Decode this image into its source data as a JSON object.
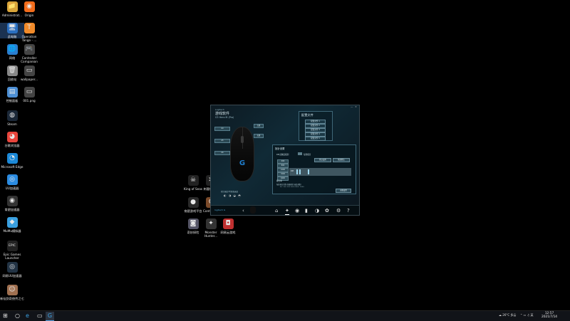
{
  "desktop": {
    "icons": [
      {
        "label": "Administrat...",
        "glyph": "📁",
        "color": "#d9a53a"
      },
      {
        "label": "Origin",
        "glyph": "◉",
        "color": "#f26c1b"
      },
      {
        "label": "此电脑",
        "glyph": "🖥",
        "color": "#2a6fc0"
      },
      {
        "label": "Operation Tango - ...",
        "glyph": "T",
        "color": "#f08a2a"
      },
      {
        "label": "网络",
        "glyph": "🌐",
        "color": "#2a7ecf"
      },
      {
        "label": "Controller Companion",
        "glyph": "🎮",
        "color": "#444"
      },
      {
        "label": "回收站",
        "glyph": "🗑",
        "color": "#888"
      },
      {
        "label": "wallpaper...",
        "glyph": "▭",
        "color": "#444"
      },
      {
        "label": "控制面板",
        "glyph": "▤",
        "color": "#4d8fd4"
      },
      {
        "label": "001.png",
        "glyph": "▭",
        "color": "#444"
      },
      {
        "label": "Steam",
        "glyph": "◍",
        "color": "#1b2838"
      },
      {
        "label": "谷歌浏览器",
        "glyph": "◕",
        "color": "#e8453c"
      },
      {
        "label": "Microsoft Edge",
        "glyph": "◔",
        "color": "#1b88d6"
      },
      {
        "label": "UU加速器",
        "glyph": "◎",
        "color": "#2b8be0"
      },
      {
        "label": "育碧加速器",
        "glyph": "◉",
        "color": "#333"
      },
      {
        "label": "MuMu模拟器",
        "glyph": "◆",
        "color": "#3aa0e0"
      },
      {
        "label": "Epic Games Launcher",
        "glyph": "EPIC",
        "color": "#222"
      },
      {
        "label": "网易UU加速器",
        "glyph": "◎",
        "color": "#234"
      },
      {
        "label": "新仙剑奇侠传之七",
        "glyph": "☺",
        "color": "#a07050"
      },
      {
        "label": "King of Seas",
        "glyph": "☠",
        "color": "#222"
      },
      {
        "label": "刺客信条...",
        "glyph": "✕",
        "color": "#222"
      },
      {
        "label": "育碧游戏平台",
        "glyph": "●",
        "color": "#2a2a2a"
      },
      {
        "label": "Contract...",
        "glyph": "C",
        "color": "#7a4a2a"
      },
      {
        "label": "奇妙探险",
        "glyph": "◙",
        "color": "#556"
      },
      {
        "label": "Monster Hunter...",
        "glyph": "✦",
        "color": "#333"
      },
      {
        "label": "网易云游戏",
        "glyph": "◘",
        "color": "#c03030"
      }
    ]
  },
  "ghub": {
    "brand": "Logitech",
    "title": "游戏软件",
    "device": "G3 Hero M (Pro)",
    "window_controls": [
      "—",
      "×"
    ],
    "profile_panel": {
      "title": "配置文件",
      "buttons": [
        "配置文件 1",
        "配置文件 2",
        "配置文件 3",
        "配置文件 4",
        "配置文件 5"
      ]
    },
    "mouse_labels_left": [
      "G4",
      "G5",
      "G6"
    ],
    "mouse_labels_right": [
      "左键",
      "右键"
    ],
    "settings": {
      "title": "指针设置",
      "dpi_label": "DPI灵敏度级别",
      "dpi_label2": "每秒报告",
      "button_1": "默认设置",
      "button_2": "恢复默认",
      "dpi_rows": [
        "400",
        "800",
        "1600",
        "3200",
        "6400"
      ],
      "graph_label": "DPI",
      "sub_title": "报告率",
      "sub_note": "每秒报告次数 (根据指针速度调整)",
      "scale": "50  100  200  400  800  1000",
      "bottom_button": "高级设置"
    },
    "note": "指针速度/平滑/加速度",
    "mini_icons": "◐ ◑ ◒ ◓",
    "bottom_bar": {
      "logo": "logitech G",
      "back_arrow": "‹",
      "tabs": [
        "⌂",
        "✦",
        "◉",
        "▮",
        "◑",
        "✿",
        "⚙",
        "?"
      ]
    }
  },
  "taskbar": {
    "start": "⊞",
    "search": "○",
    "apps": [
      "▭",
      "e",
      "G"
    ],
    "weather": "☁ 26°C 多云",
    "tray": "⌃ ▭ ♫ 英",
    "time": "12:57",
    "date": "2021/7/14"
  }
}
